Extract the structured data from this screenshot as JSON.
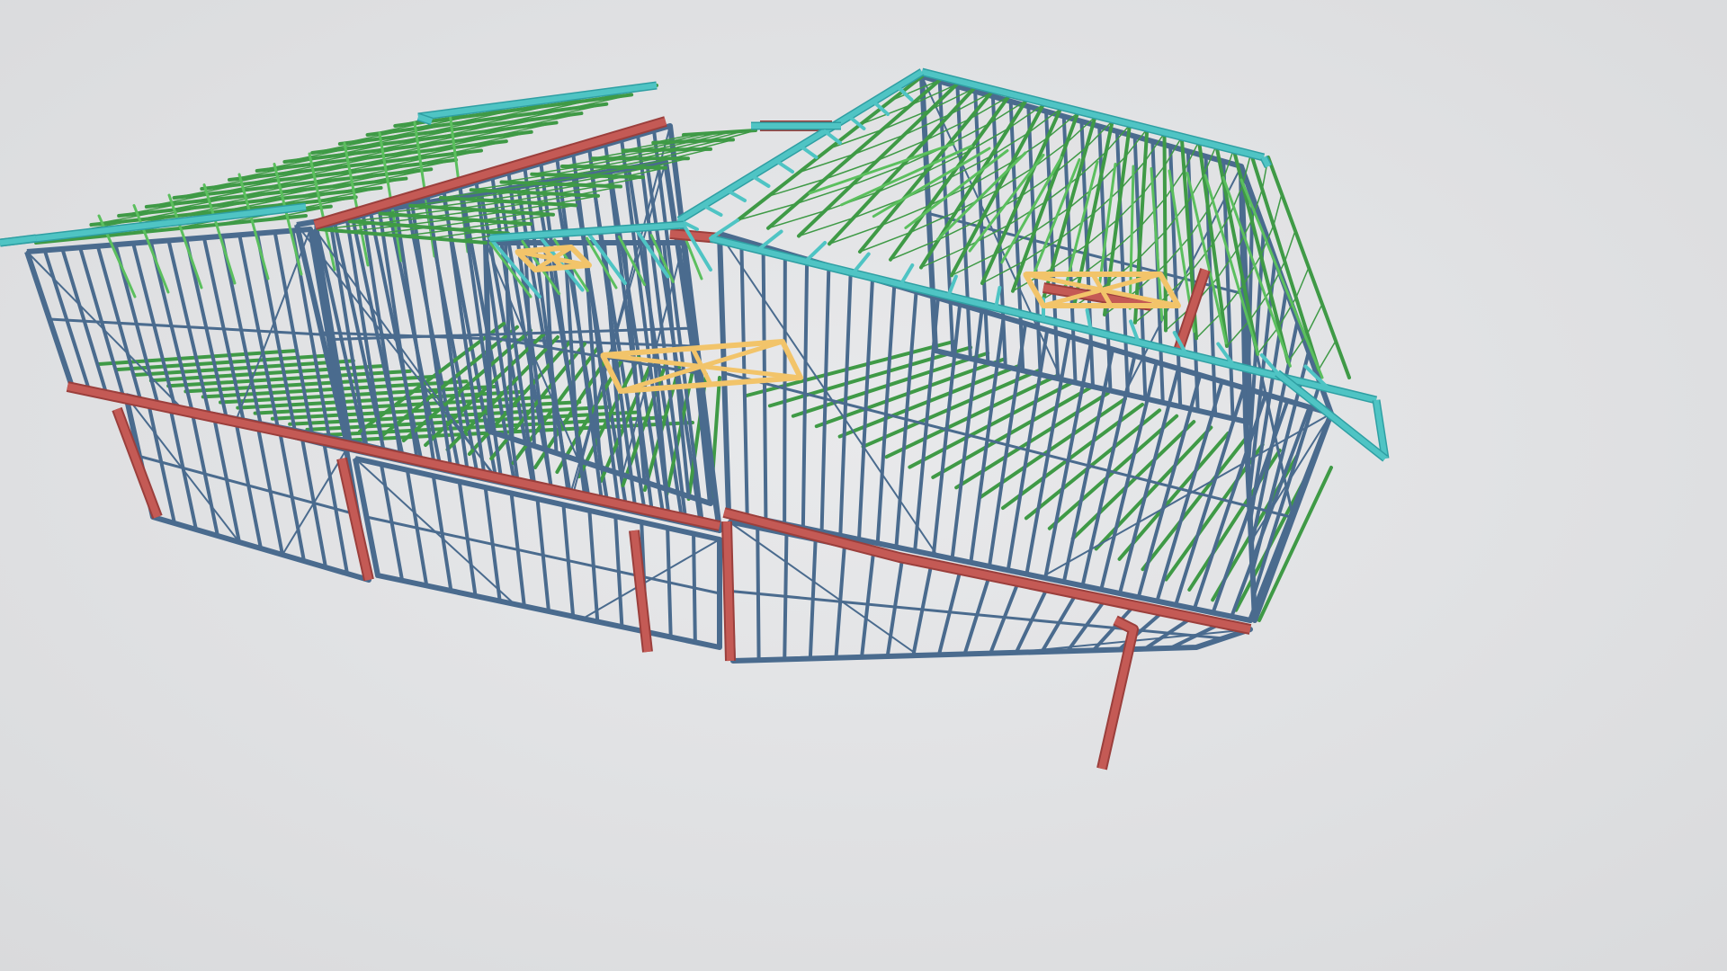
{
  "scene": {
    "subject": "steel-frame-house-model",
    "colors": {
      "background": "#e3e4e6",
      "background_edge": "#d7d8da",
      "wall_frame": "#4a6b8e",
      "wall_frame_dark": "#35506e",
      "truss": "#3f9a46",
      "truss_light": "#5bbf5e",
      "roof_edge": "#4fc4c4",
      "roof_edge_dark": "#2f9fa3",
      "bearer": "#c45a55",
      "bearer_dark": "#9b3f3c",
      "manhole": "#f2c46a"
    }
  }
}
